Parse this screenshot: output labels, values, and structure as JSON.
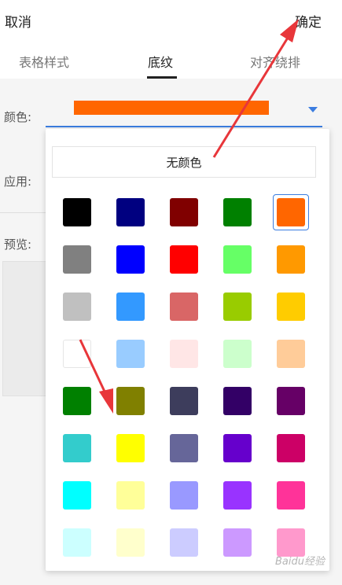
{
  "header": {
    "cancel_label": "取消",
    "confirm_label": "确定"
  },
  "tabs": [
    {
      "label": "表格样式",
      "active": false
    },
    {
      "label": "底纹",
      "active": true
    },
    {
      "label": "对齐绕排",
      "active": false
    }
  ],
  "settings": {
    "color_label": "颜色:",
    "apply_label": "应用:",
    "preview_label": "预览:",
    "selected_color": "#FF6600"
  },
  "palette": {
    "no_color_label": "无颜色",
    "selected_index": 4,
    "colors": [
      "#000000",
      "#000080",
      "#800000",
      "#008000",
      "#FF6600",
      "#808080",
      "#0000FF",
      "#FF0000",
      "#66FF66",
      "#FF9900",
      "#C0C0C0",
      "#3399FF",
      "#D96666",
      "#99CC00",
      "#FFCC00",
      "#FFFFFF",
      "#99CCFF",
      "#FFE6E6",
      "#CCFFCC",
      "#FFCC99",
      "#008000",
      "#808000",
      "#3D3D5C",
      "#330066",
      "#660066",
      "#33CCCC",
      "#FFFF00",
      "#666699",
      "#6600CC",
      "#CC0066",
      "#00FFFF",
      "#FFFF99",
      "#9999FF",
      "#9933FF",
      "#FF3399",
      "#CCFFFF",
      "#FFFFCC",
      "#CCCCFF",
      "#CC99FF",
      "#FF99CC"
    ]
  },
  "watermark": "Baidu经验"
}
